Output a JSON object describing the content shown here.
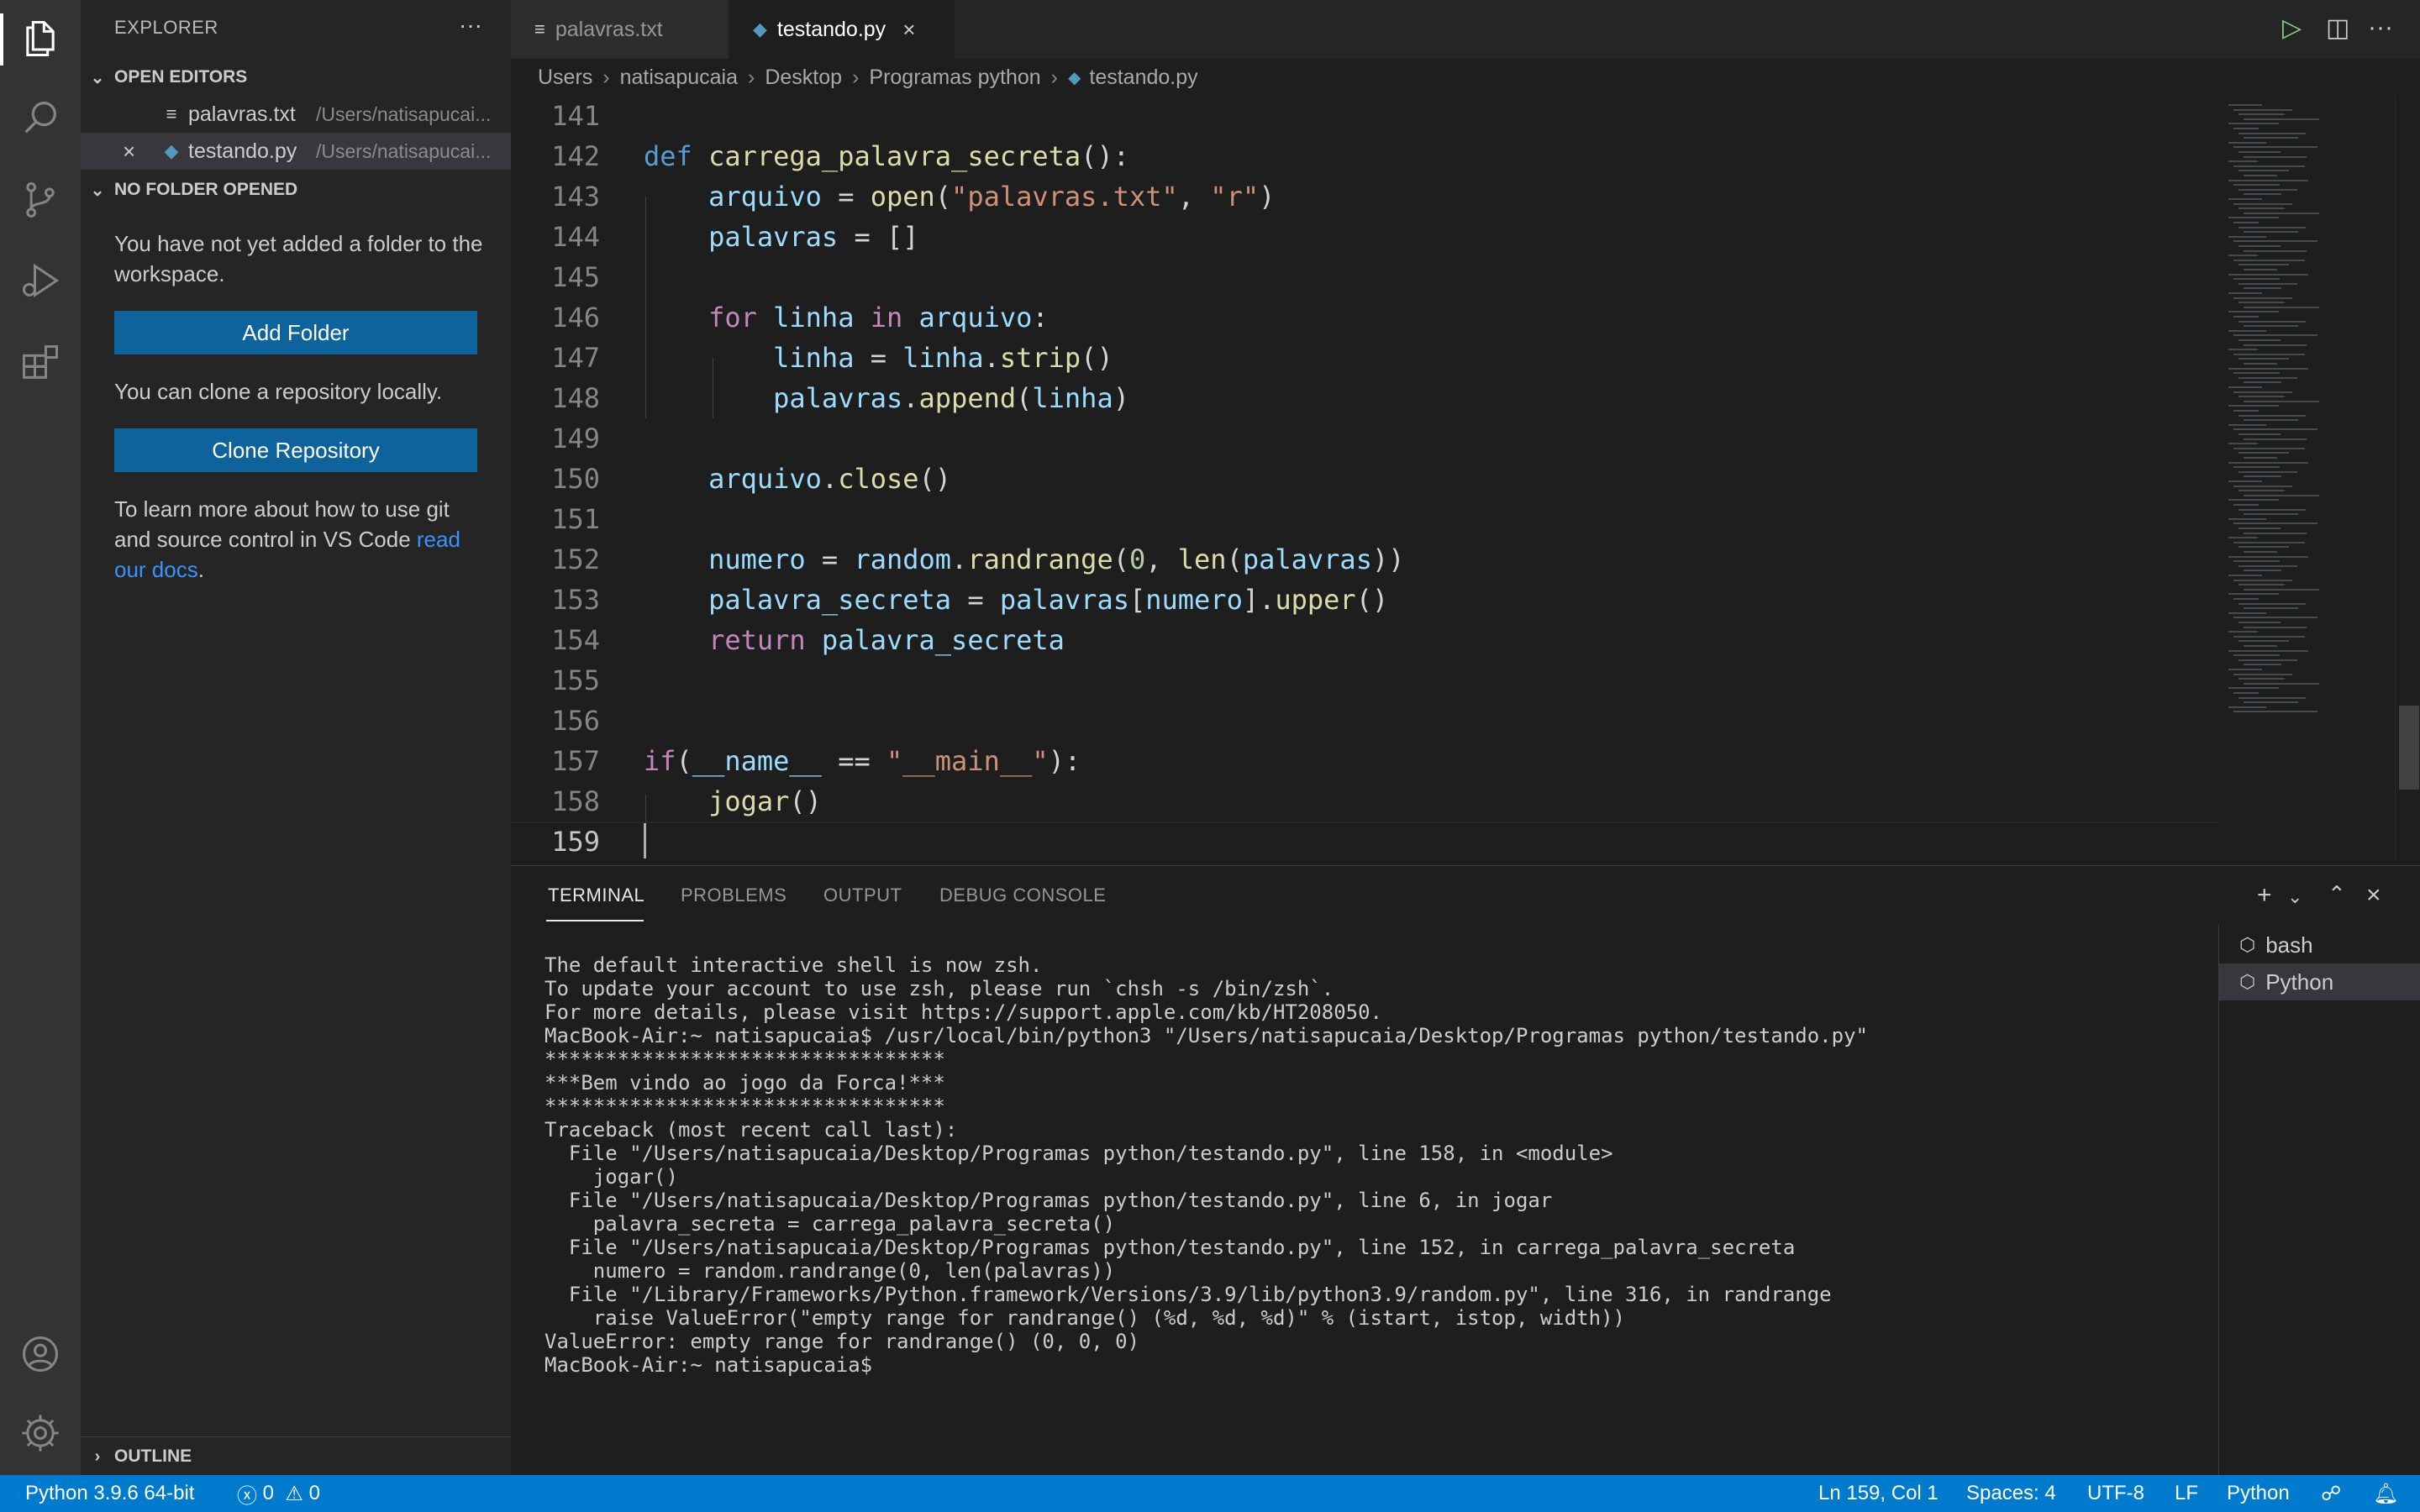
{
  "sidebar": {
    "title": "EXPLORER",
    "more": "···",
    "open_editors": {
      "label": "OPEN EDITORS",
      "items": [
        {
          "name": "palavras.txt",
          "path": "/Users/natisapucai..."
        },
        {
          "name": "testando.py",
          "path": "/Users/natisapucai..."
        }
      ]
    },
    "no_folder": {
      "label": "NO FOLDER OPENED",
      "text1": "You have not yet added a folder to the workspace.",
      "add_folder": "Add Folder",
      "text2": "You can clone a repository locally.",
      "clone_repo": "Clone Repository",
      "text3_a": "To learn more about how to use git and source control in VS Code ",
      "text3_link": "read our docs",
      "text3_b": "."
    },
    "outline_label": "OUTLINE"
  },
  "tabs": [
    {
      "label": "palavras.txt"
    },
    {
      "label": "testando.py"
    }
  ],
  "breadcrumb": [
    "Users",
    "natisapucaia",
    "Desktop",
    "Programas python",
    "testando.py"
  ],
  "code": {
    "line_numbers": [
      "141",
      "142",
      "143",
      "144",
      "145",
      "146",
      "147",
      "148",
      "149",
      "150",
      "151",
      "152",
      "153",
      "154",
      "155",
      "156",
      "157",
      "158",
      "159"
    ],
    "current_line": "159"
  },
  "panel": {
    "tabs": [
      "TERMINAL",
      "PROBLEMS",
      "OUTPUT",
      "DEBUG CONSOLE"
    ],
    "terminal_lines": [
      "The default interactive shell is now zsh.",
      "To update your account to use zsh, please run `chsh -s /bin/zsh`.",
      "For more details, please visit https://support.apple.com/kb/HT208050.",
      "MacBook-Air:~ natisapucaia$ /usr/local/bin/python3 \"/Users/natisapucaia/Desktop/Programas python/testando.py\"",
      "*********************************",
      "***Bem vindo ao jogo da Forca!***",
      "*********************************",
      "Traceback (most recent call last):",
      "  File \"/Users/natisapucaia/Desktop/Programas python/testando.py\", line 158, in <module>",
      "    jogar()",
      "  File \"/Users/natisapucaia/Desktop/Programas python/testando.py\", line 6, in jogar",
      "    palavra_secreta = carrega_palavra_secreta()",
      "  File \"/Users/natisapucaia/Desktop/Programas python/testando.py\", line 152, in carrega_palavra_secreta",
      "    numero = random.randrange(0, len(palavras))",
      "  File \"/Library/Frameworks/Python.framework/Versions/3.9/lib/python3.9/random.py\", line 316, in randrange",
      "    raise ValueError(\"empty range for randrange() (%d, %d, %d)\" % (istart, istop, width))",
      "ValueError: empty range for randrange() (0, 0, 0)",
      "MacBook-Air:~ natisapucaia$ "
    ],
    "terminals": [
      "bash",
      "Python"
    ]
  },
  "status": {
    "interpreter": "Python 3.9.6 64-bit",
    "errors": "0",
    "warnings": "0",
    "position": "Ln 159, Col 1",
    "spaces": "Spaces: 4",
    "encoding": "UTF-8",
    "eol": "LF",
    "language": "Python"
  },
  "colors": {
    "accent": "#007acc",
    "button": "#0e639c",
    "link": "#3794ff"
  }
}
